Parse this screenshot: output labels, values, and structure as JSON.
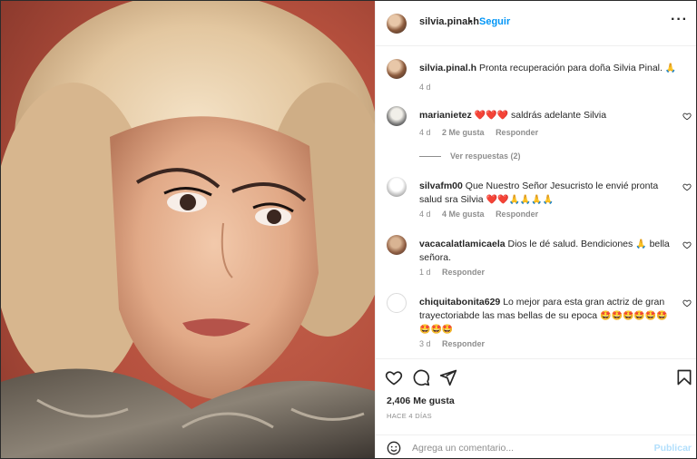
{
  "post": {
    "username": "silvia.pinal.h",
    "separator": "•",
    "follow_label": "Seguir",
    "more_label": "···",
    "caption_text": "Pronta recuperación para doña Silvia Pinal.",
    "caption_emoji": "🙏",
    "caption_time": "4 d"
  },
  "comments": [
    {
      "user": "marianietez",
      "emoji_prefix": "❤️❤️❤️",
      "text": "saldrás adelante Silvia",
      "time": "4 d",
      "likes": "2 Me gusta",
      "reply": "Responder",
      "view_replies": "Ver respuestas (2)"
    },
    {
      "user": "silvafm00",
      "text": "Que Nuestro Señor Jesucristo le envié pronta salud sra Silvia",
      "emoji_suffix": "❤️❤️🙏🙏🙏🙏",
      "time": "4 d",
      "likes": "4 Me gusta",
      "reply": "Responder"
    },
    {
      "user": "vacacalatlamicaela",
      "text": "Dios le dé salud. Bendiciones",
      "emoji_mid": "🙏",
      "text_after": "bella señora.",
      "time": "1 d",
      "reply": "Responder"
    },
    {
      "user": "chiquitabonita629",
      "text": "Lo mejor para esta gran actriz de gran trayectoriabde las mas bellas de su epoca",
      "emoji_suffix": "🤩🤩🤩🤩🤩🤩🤩🤩🤩",
      "time": "3 d",
      "reply": "Responder"
    }
  ],
  "actions": {
    "like_icon": "heart-icon",
    "comment_icon": "comment-icon",
    "share_icon": "send-icon",
    "save_icon": "bookmark-icon"
  },
  "stats": {
    "likes": "2,406 Me gusta",
    "posted": "HACE 4 DÍAS"
  },
  "compose": {
    "placeholder": "Agrega un comentario...",
    "publish_label": "Publicar"
  },
  "colors": {
    "link_blue": "#0095f6",
    "publish_disabled": "#b2dffc",
    "muted": "#8e8e8e",
    "text": "#262626"
  }
}
